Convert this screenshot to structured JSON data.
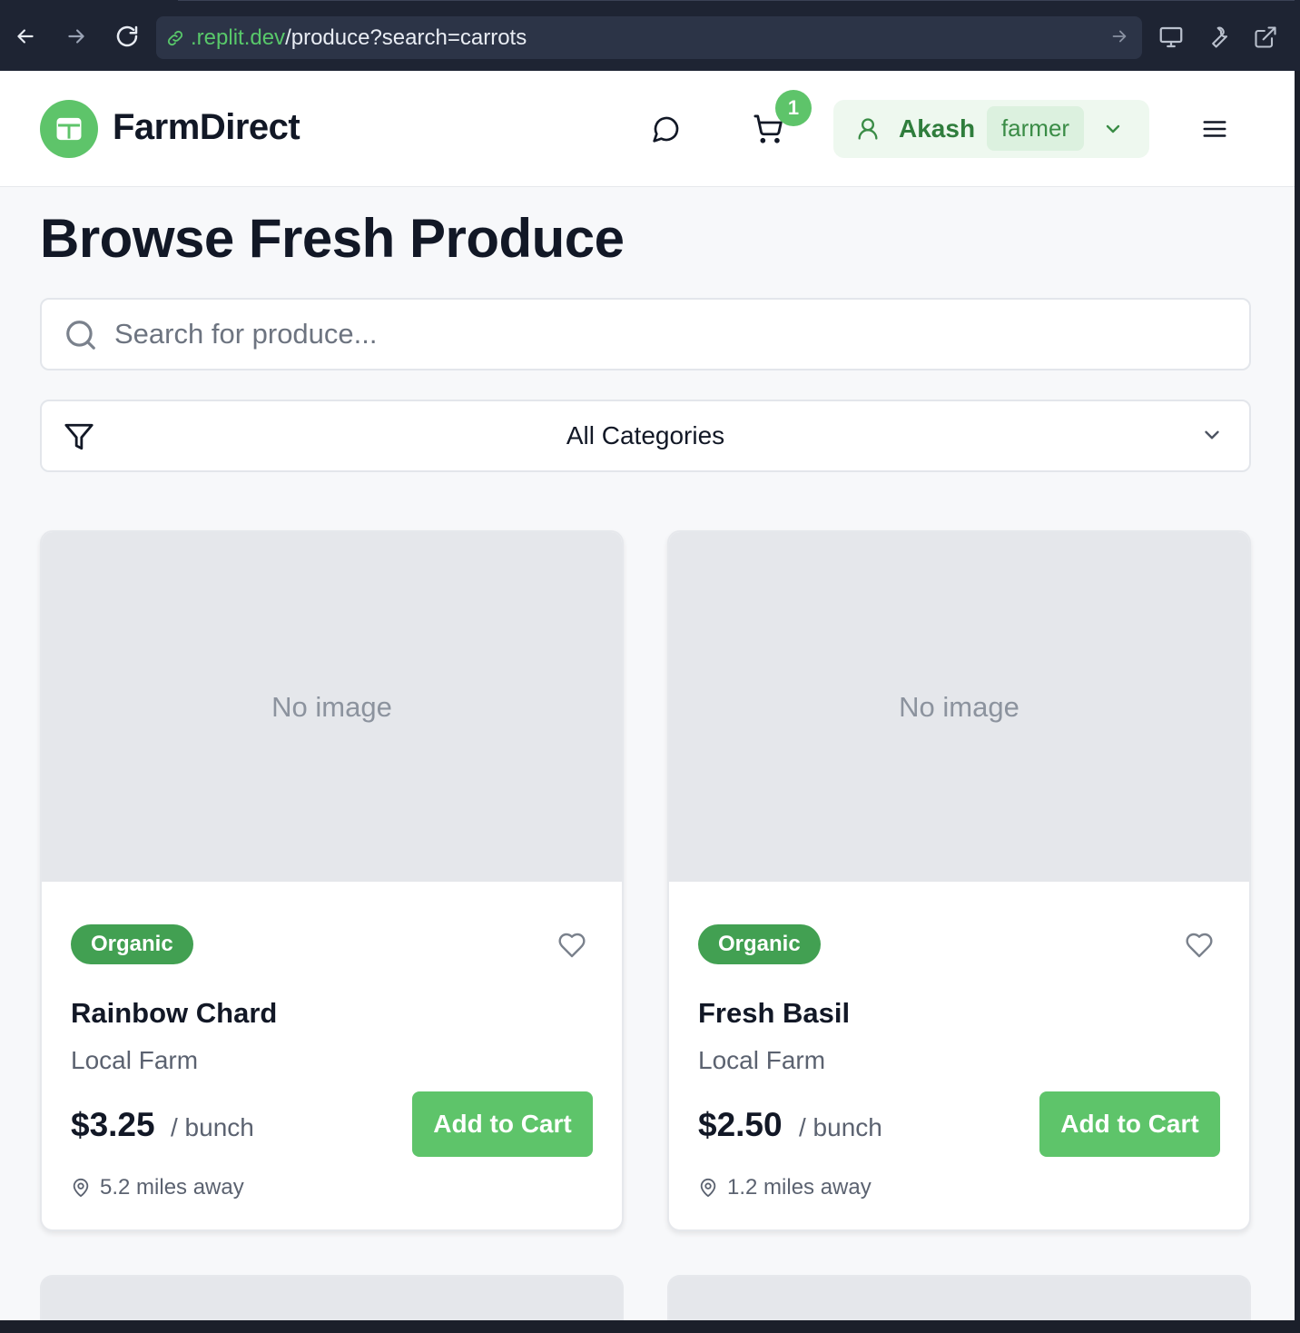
{
  "browser": {
    "url_host": ".replit.dev",
    "url_path": "/produce?search=carrots"
  },
  "header": {
    "brand": "FarmDirect",
    "cart_count": "1",
    "user_name": "Akash",
    "user_role": "farmer"
  },
  "main": {
    "title": "Browse Fresh Produce",
    "search_placeholder": "Search for produce...",
    "category_selected": "All Categories"
  },
  "products": [
    {
      "image_text": "No image",
      "badge": "Organic",
      "name": "Rainbow Chard",
      "farm": "Local Farm",
      "price": "$3.25",
      "unit": "/ bunch",
      "button": "Add to Cart",
      "distance": "5.2 miles away"
    },
    {
      "image_text": "No image",
      "badge": "Organic",
      "name": "Fresh Basil",
      "farm": "Local Farm",
      "price": "$2.50",
      "unit": "/ bunch",
      "button": "Add to Cart",
      "distance": "1.2 miles away"
    }
  ],
  "colors": {
    "accent": "#5ec46a",
    "badge": "#42a052",
    "text": "#121826"
  }
}
